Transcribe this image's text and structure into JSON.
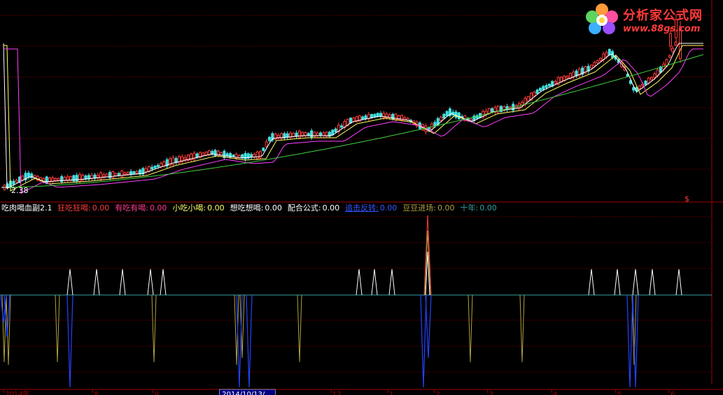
{
  "indicator": {
    "name": "吃肉喝血副2.1",
    "items": [
      {
        "label": "狂吃狂喝:",
        "value": "0.00",
        "color": "#ff3b3b"
      },
      {
        "label": "有吃有喝:",
        "value": "0.00",
        "color": "#ff3b8a"
      },
      {
        "label": "小吃小喝:",
        "value": "0.00",
        "color": "#ffff66"
      },
      {
        "label": "想吃想喝:",
        "value": "0.00",
        "color": "#ffffff"
      },
      {
        "label": "配合公式:",
        "value": "0.00",
        "color": "#ffffff"
      },
      {
        "label": "追击反转:",
        "value": "0.00",
        "color": "#3355ff"
      },
      {
        "label": "豆豆进场:",
        "value": "0.00",
        "color": "#b0a040"
      },
      {
        "label": "十年:",
        "value": "0.00",
        "color": "#30a0a0"
      }
    ]
  },
  "price_panel": {
    "low_marker": "2.38",
    "dollar_marker": "$"
  },
  "watermark": {
    "title": "分析家公式网",
    "url": "www.88gs.com"
  },
  "date_axis": {
    "labels": [
      {
        "text": "2014年",
        "pos": 0.005
      },
      {
        "text": "8",
        "pos": 0.13
      },
      {
        "text": "9",
        "pos": 0.215
      },
      {
        "text": "2014/10/13/",
        "pos": 0.31
      },
      {
        "text": "12",
        "pos": 0.465
      },
      {
        "text": "1",
        "pos": 0.545
      },
      {
        "text": "2",
        "pos": 0.61
      },
      {
        "text": "3",
        "pos": 0.685
      },
      {
        "text": "4",
        "pos": 0.775
      },
      {
        "text": "5",
        "pos": 0.865
      },
      {
        "text": "6",
        "pos": 0.94
      }
    ]
  },
  "colors": {
    "background": "#000000",
    "up_candle": "#ff3b3b",
    "down_candle": "#40e0e0",
    "ma_short": "#ffffff",
    "ma_mid": "#ffff66",
    "ma_long": "#ff40ff",
    "ma_year": "#40d040",
    "grid": "#8b0000",
    "signal_white": "#ffffff",
    "signal_olive": "#b0a040",
    "signal_blue": "#2244ff",
    "signal_baseline": "#30a0a0"
  }
}
